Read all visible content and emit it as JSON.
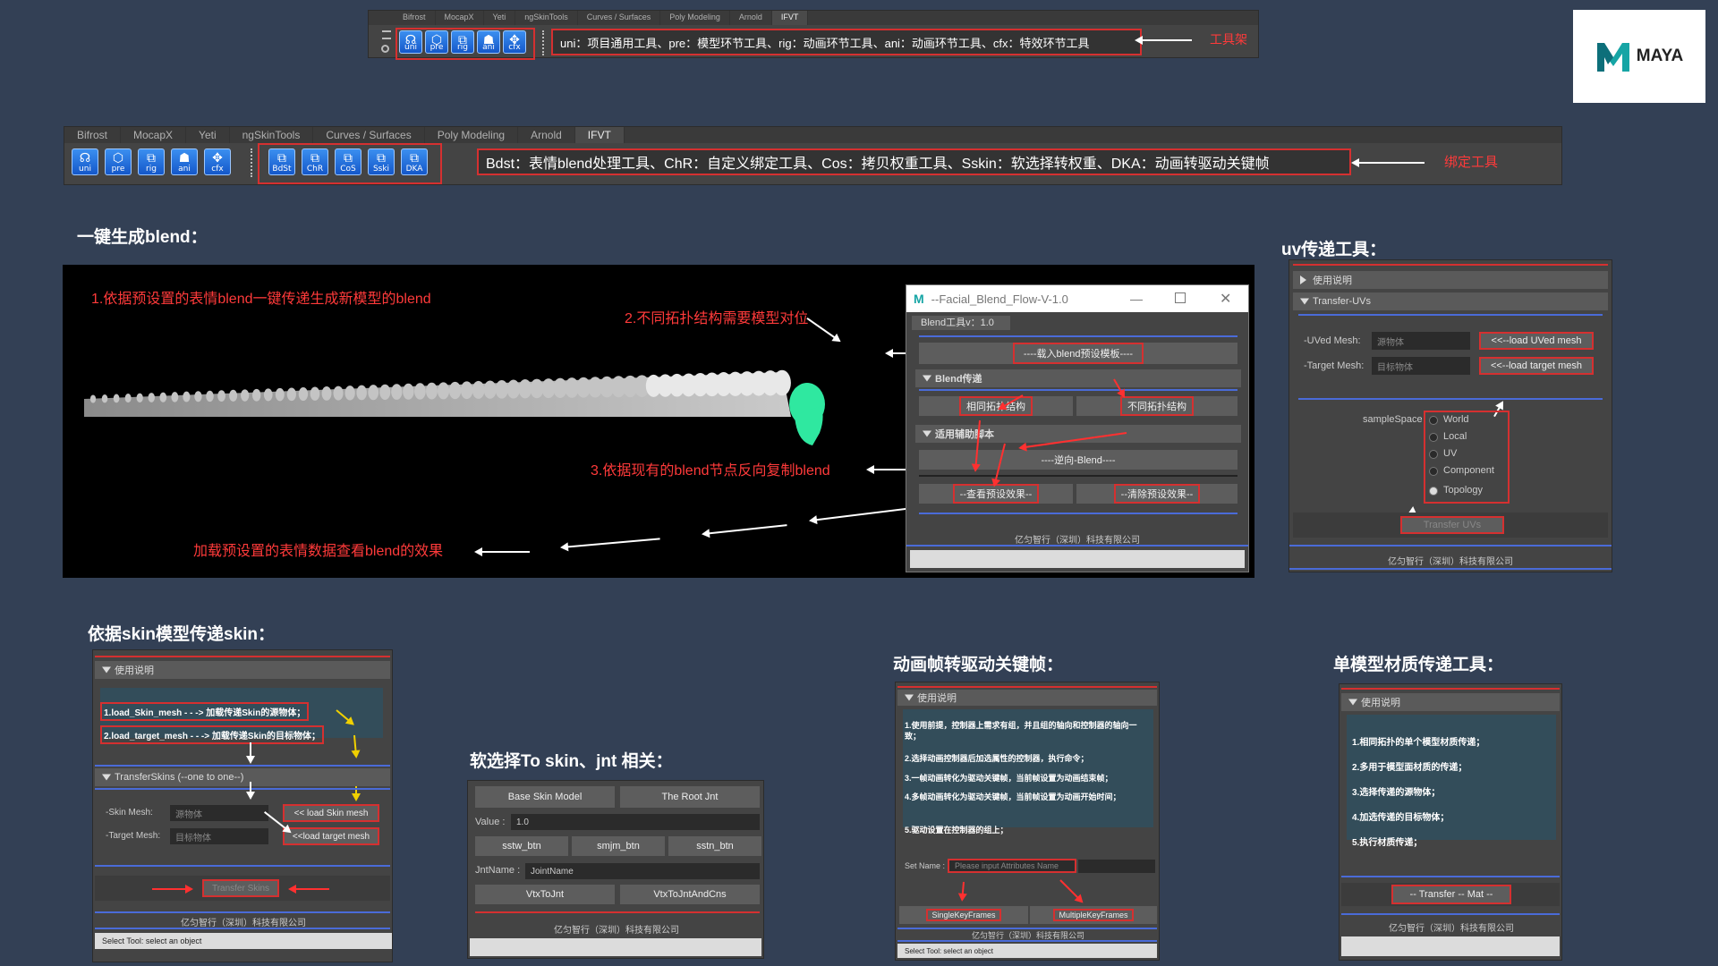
{
  "top_shelf": {
    "tabs": [
      "Bifrost",
      "MocapX",
      "Yeti",
      "ngSkinTools",
      "Curves / Surfaces",
      "Poly Modeling",
      "Arnold",
      "IFVT"
    ],
    "active_tab": "IFVT",
    "icons": [
      {
        "label": "uni",
        "icon": "mask-icon"
      },
      {
        "label": "pre",
        "icon": "cube-icon"
      },
      {
        "label": "rig",
        "icon": "rig-icon"
      },
      {
        "label": "ani",
        "icon": "crowd-icon"
      },
      {
        "label": "cfx",
        "icon": "cfx-icon"
      }
    ],
    "description": "uni：项目通用工具、pre：模型环节工具、rig：动画环节工具、ani：动画环节工具、cfx：特效环节工具",
    "annotation": "工具架"
  },
  "logo": {
    "text": "MAYA"
  },
  "main_shelf": {
    "tabs": [
      "Bifrost",
      "MocapX",
      "Yeti",
      "ngSkinTools",
      "Curves / Surfaces",
      "Poly Modeling",
      "Arnold",
      "IFVT"
    ],
    "active_tab": "IFVT",
    "icons": [
      {
        "label": "uni"
      },
      {
        "label": "pre"
      },
      {
        "label": "rig"
      },
      {
        "label": "ani"
      },
      {
        "label": "cfx"
      }
    ],
    "bind_icons": [
      {
        "label": "BdSt"
      },
      {
        "label": "ChR"
      },
      {
        "label": "CoS"
      },
      {
        "label": "Sski"
      },
      {
        "label": "DKA"
      }
    ],
    "description": "Bdst：表情blend处理工具、ChR：自定义绑定工具、Cos：拷贝权重工具、Sskin：软选择转权重、DKA：动画转驱动关键帧",
    "annotation": "绑定工具"
  },
  "section_blend": {
    "heading": "一键生成blend：",
    "note1": "1.依据预设置的表情blend一键传递生成新模型的blend",
    "note2": "2.不同拓扑结构需要模型对位",
    "note3": "3.依据现有的blend节点反向复制blend",
    "note4": "加载预设置的表情数据查看blend的效果",
    "window": {
      "title": "--Facial_Blend_Flow-V-1.0",
      "tab": "Blend工具v：1.0",
      "load_preset": "----载入blend预设模板----",
      "section1": "Blend传递",
      "same_topo": "相同拓扑结构",
      "diff_topo": "不同拓扑结构",
      "section2": "适用辅助脚本",
      "reverse": "----逆向-Blend----",
      "view_preset": "--查看预设效果--",
      "clear_preset": "--清除预设效果--",
      "footer": "亿匀智行（深圳）科技有限公司"
    }
  },
  "section_uv": {
    "heading": "uv传递工具：",
    "help": "使用说明",
    "transfer_section": "Transfer-UVs",
    "uved_label": "-UVed Mesh:",
    "uved_placeholder": "源物体",
    "load_uved": "<<--load UVed mesh",
    "target_label": "-Target Mesh:",
    "target_placeholder": "目标物体",
    "load_target": "<<--load target mesh",
    "sample_label": "sampleSpace",
    "options": [
      "World",
      "Local",
      "UV",
      "Component",
      "Topology"
    ],
    "selected": "Topology",
    "transfer": "Transfer UVs",
    "footer": "亿匀智行（深圳）科技有限公司"
  },
  "section_skin": {
    "heading": "依据skin模型传递skin：",
    "help": "使用说明",
    "line1": "1.load_Skin_mesh - - -> 加载传递Skin的源物体；",
    "line2": "2.load_target_mesh - - -> 加载传递Skin的目标物体；",
    "transfer_section": "TransferSkins (--one to one--)",
    "skin_label": "-Skin    Mesh:",
    "skin_placeholder": "源物体",
    "load_skin": "<<  load Skin mesh",
    "target_label": "-Target Mesh:",
    "target_placeholder": "目标物体",
    "load_target": "<<load target mesh",
    "transfer": "Transfer Skins",
    "footer": "亿匀智行（深圳）科技有限公司",
    "status": "Select Tool: select an object"
  },
  "section_soft": {
    "heading": "软选择To skin、jnt 相关：",
    "base_skin": "Base Skin Model",
    "root_jnt": "The Root Jnt",
    "value_label": "Value :",
    "value": "1.0",
    "btn1": "sstw_btn",
    "btn2": "smjm_btn",
    "btn3": "sstn_btn",
    "jnt_label": "JntName :",
    "jnt_value": "JointName",
    "vtx1": "VtxToJnt",
    "vtx2": "VtxToJntAndCns",
    "footer": "亿匀智行（深圳）科技有限公司"
  },
  "section_anim": {
    "heading": "动画帧转驱动关键帧：",
    "help": "使用说明",
    "lines": [
      "1.使用前提，控制器上需求有组，并且组的轴向和控制器的轴向一致；",
      "2.选择动画控制器后加选属性的控制器，执行命令；",
      "3.一帧动画转化为驱动关键帧，当前帧设置为动画结束帧；",
      "4.多帧动画转化为驱动关键帧，当前帧设置为动画开始时间；",
      "5.驱动设置在控制器的组上；"
    ],
    "set_label": "Set Name :",
    "set_placeholder": "Please input Attributes Name",
    "single": "SingleKeyFrames",
    "multiple": "MultipleKeyFrames",
    "footer": "亿匀智行（深圳）科技有限公司",
    "status": "Select Tool: select an object"
  },
  "section_mat": {
    "heading": "单模型材质传递工具：",
    "help": "使用说明",
    "lines": [
      "1.相同拓扑的单个模型材质传递；",
      "2.多用于模型面材质的传递；",
      "3.选择传递的源物体；",
      "4.加选传递的目标物体；",
      "5.执行材质传递；"
    ],
    "transfer": "-- Transfer -- Mat --",
    "footer": "亿匀智行（深圳）科技有限公司"
  }
}
